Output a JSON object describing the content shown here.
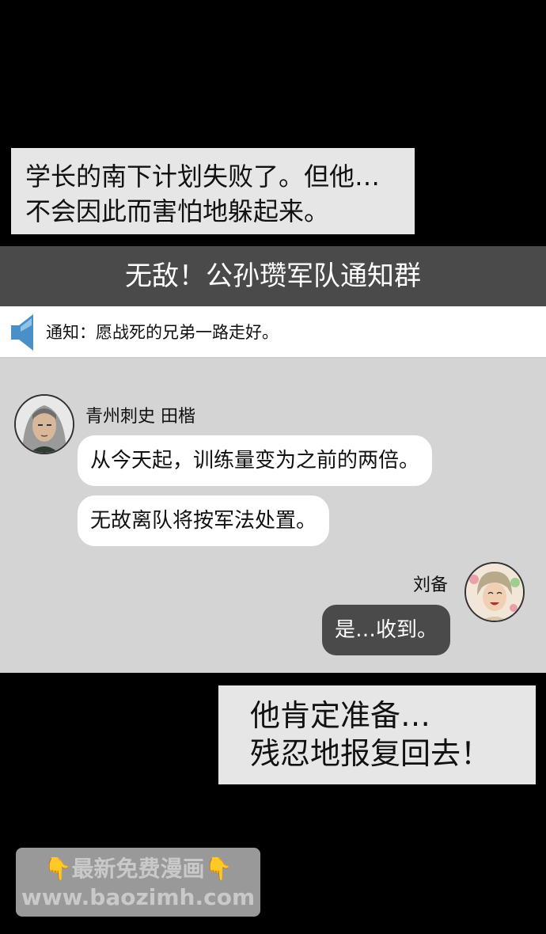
{
  "caption_top": {
    "line1": "学长的南下计划失败了。但他…",
    "line2": "不会因此而害怕地躲起来。"
  },
  "chat": {
    "group_title": "无敌！公孙瓒军队通知群",
    "notice": {
      "icon": "speaker-icon",
      "text": "通知：愿战死的兄弟一路走好。"
    },
    "messages": [
      {
        "sender": "青州刺史 田楷",
        "side": "left",
        "bubbles": [
          "从今天起，训练量变为之前的两倍。",
          "无故离队将按军法处置。"
        ]
      },
      {
        "sender": "刘备",
        "side": "right",
        "bubbles": [
          "是…收到。"
        ]
      }
    ]
  },
  "caption_bottom": {
    "line1": "他肯定准备…",
    "line2": "残忍地报复回去！"
  },
  "watermark": {
    "hand_left": "👇",
    "text": "最新免费漫画",
    "hand_right": "👇",
    "url": "www.baozimh.com"
  },
  "colors": {
    "page_background": "#000000",
    "caption_background": "#e6e6e6",
    "header_background": "#4a4a4a",
    "chat_background": "#d4d4d4",
    "incoming_bubble": "#ffffff",
    "outgoing_bubble": "#4a4a4a",
    "speaker_icon": "#4a90c8"
  }
}
